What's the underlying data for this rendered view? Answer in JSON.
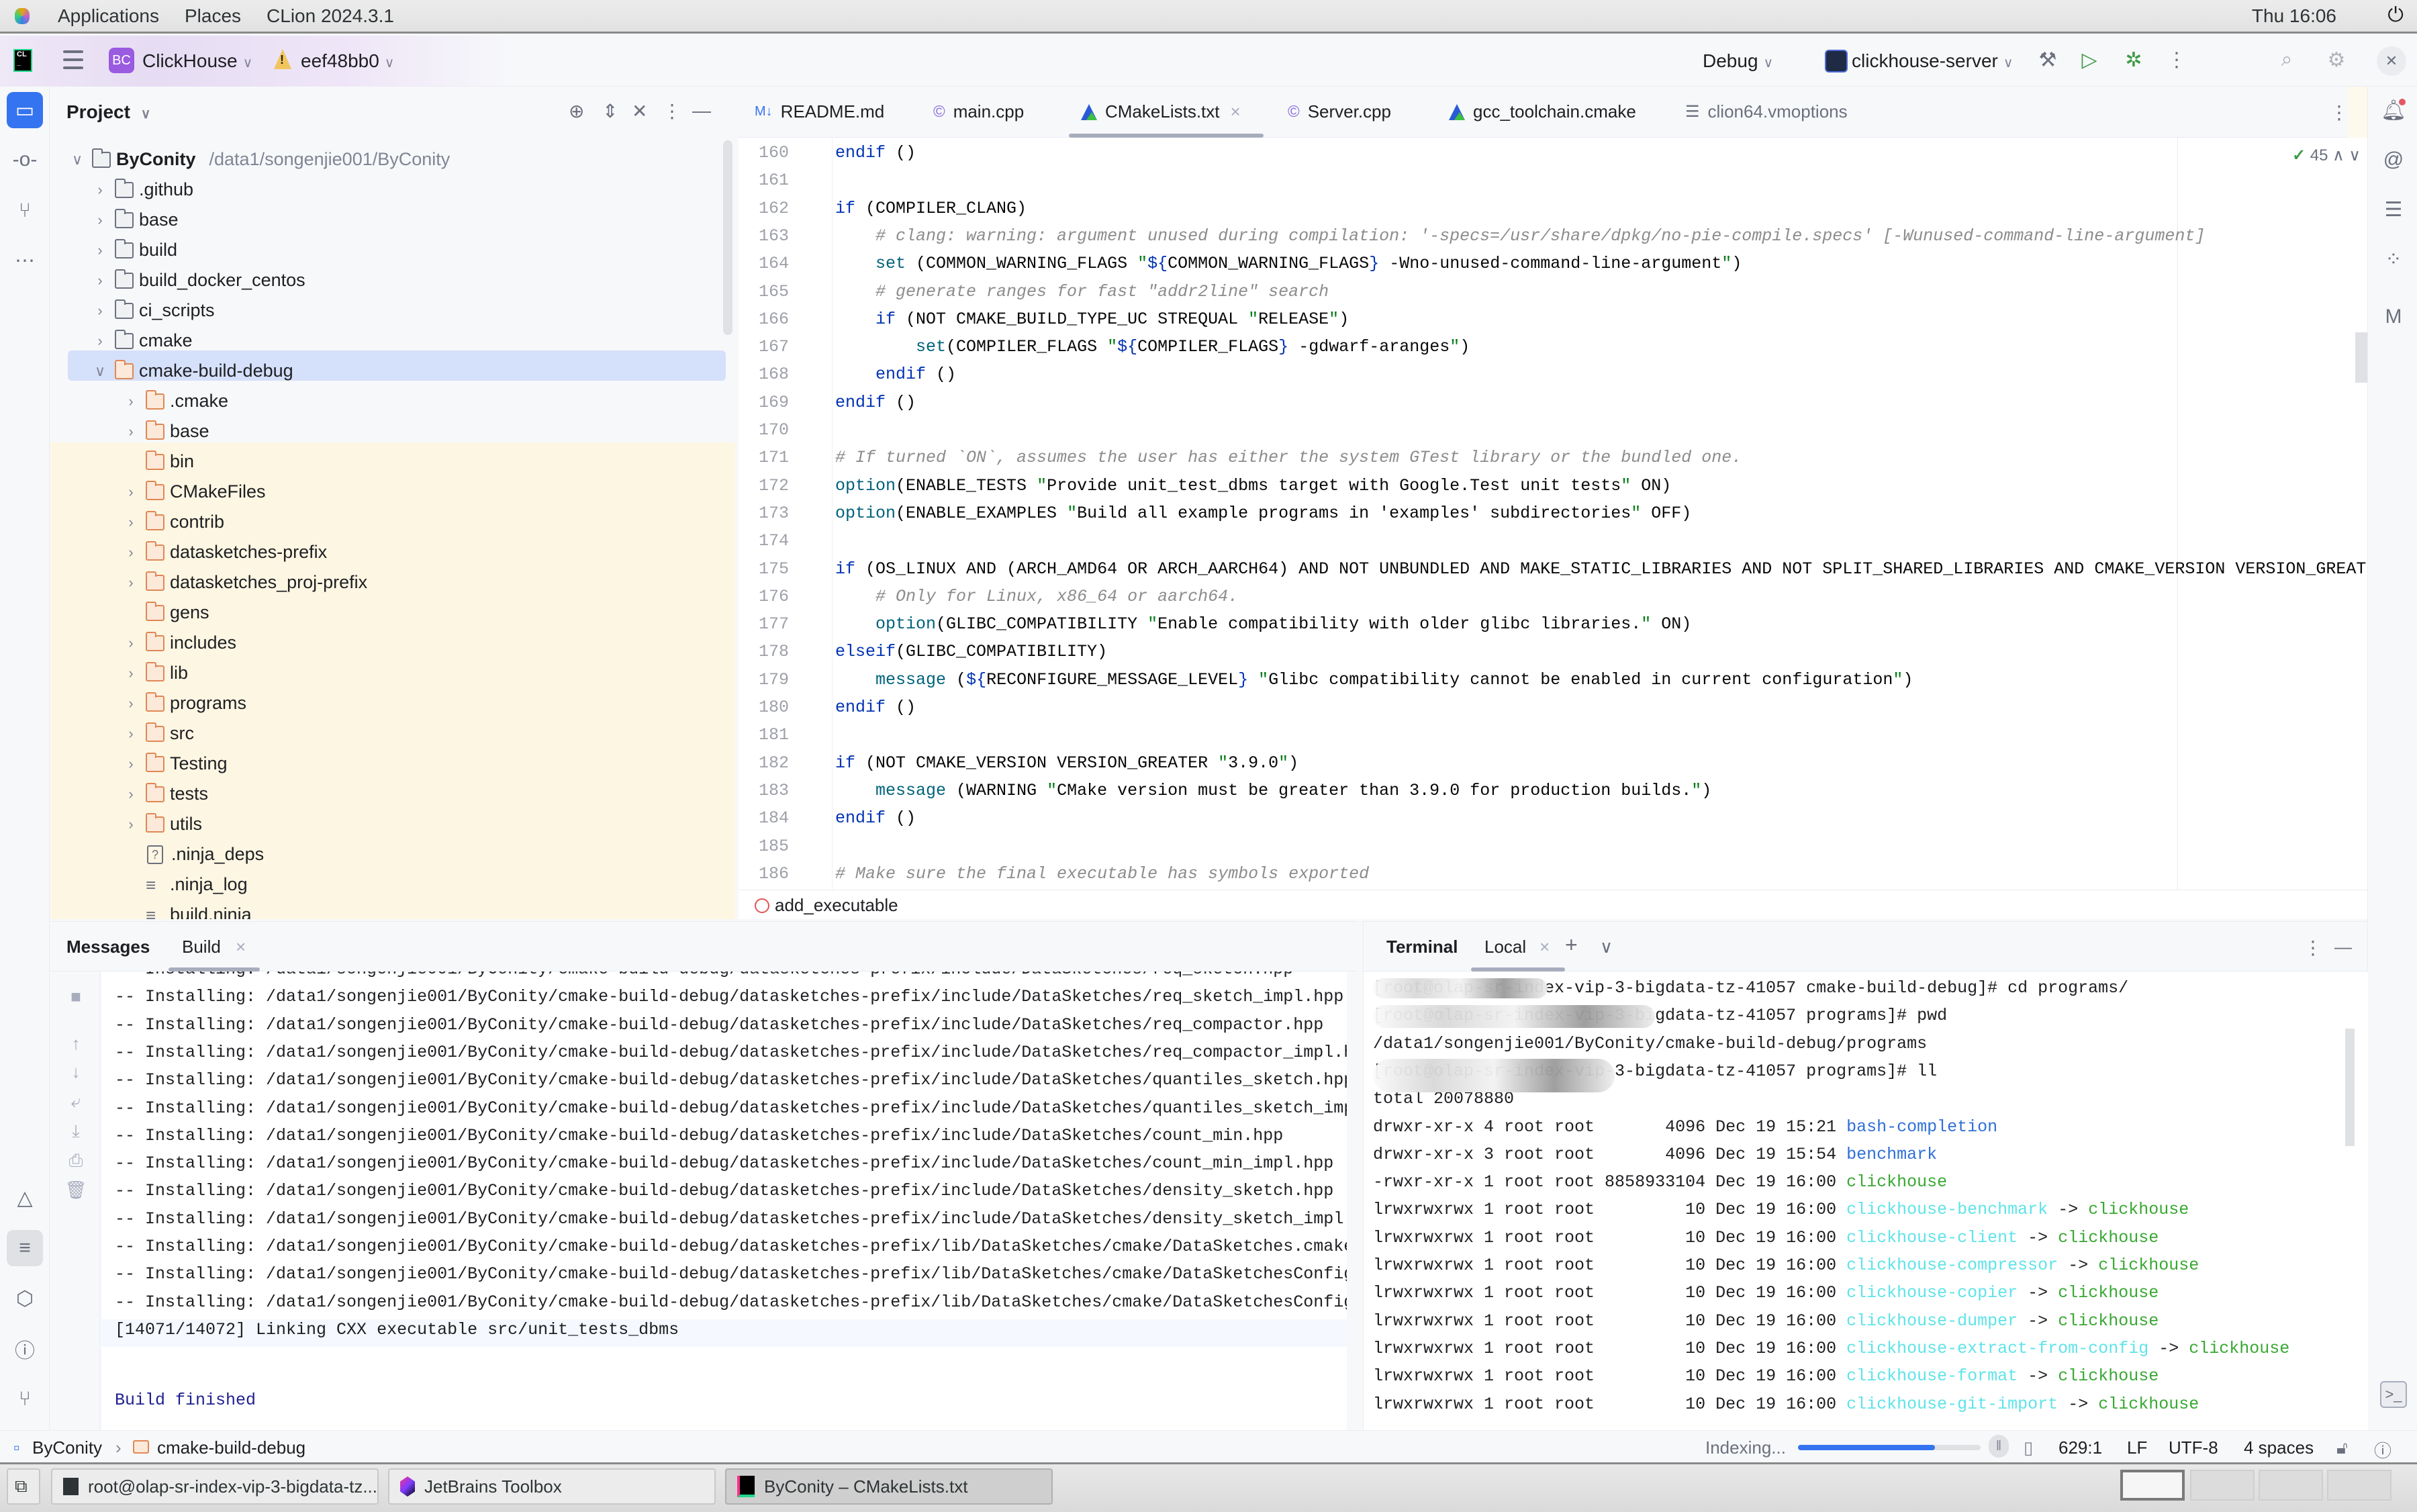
{
  "system_bar": {
    "menus": [
      "Applications",
      "Places",
      "CLion 2024.3.1"
    ],
    "clock": "Thu 16:06"
  },
  "header": {
    "project_badge": "BC",
    "project_name": "ClickHouse",
    "branch": "eef48bb0",
    "build_config": "Debug",
    "run_config": "clickhouse-server"
  },
  "project_panel": {
    "title": "Project",
    "root": {
      "name": "ByConity",
      "path": "/data1/songenjie001/ByConity"
    },
    "items": [
      {
        "name": ".github",
        "depth": 1,
        "type": "folder",
        "expandable": true
      },
      {
        "name": "base",
        "depth": 1,
        "type": "folder",
        "expandable": true
      },
      {
        "name": "build",
        "depth": 1,
        "type": "folder",
        "expandable": true
      },
      {
        "name": "build_docker_centos",
        "depth": 1,
        "type": "folder",
        "expandable": true
      },
      {
        "name": "ci_scripts",
        "depth": 1,
        "type": "folder",
        "expandable": true
      },
      {
        "name": "cmake",
        "depth": 1,
        "type": "folder",
        "expandable": true
      },
      {
        "name": "cmake-build-debug",
        "depth": 1,
        "type": "folder-excluded",
        "expandable": true,
        "expanded": true,
        "selected": true
      },
      {
        "name": ".cmake",
        "depth": 2,
        "type": "folder-excluded",
        "expandable": true
      },
      {
        "name": "base",
        "depth": 2,
        "type": "folder-excluded",
        "expandable": true
      },
      {
        "name": "bin",
        "depth": 2,
        "type": "folder-excluded",
        "expandable": false
      },
      {
        "name": "CMakeFiles",
        "depth": 2,
        "type": "folder-excluded",
        "expandable": true
      },
      {
        "name": "contrib",
        "depth": 2,
        "type": "folder-excluded",
        "expandable": true
      },
      {
        "name": "datasketches-prefix",
        "depth": 2,
        "type": "folder-excluded",
        "expandable": true
      },
      {
        "name": "datasketches_proj-prefix",
        "depth": 2,
        "type": "folder-excluded",
        "expandable": true
      },
      {
        "name": "gens",
        "depth": 2,
        "type": "folder-excluded",
        "expandable": false
      },
      {
        "name": "includes",
        "depth": 2,
        "type": "folder-excluded",
        "expandable": true
      },
      {
        "name": "lib",
        "depth": 2,
        "type": "folder-excluded",
        "expandable": true
      },
      {
        "name": "programs",
        "depth": 2,
        "type": "folder-excluded",
        "expandable": true
      },
      {
        "name": "src",
        "depth": 2,
        "type": "folder-excluded",
        "expandable": true
      },
      {
        "name": "Testing",
        "depth": 2,
        "type": "folder-excluded",
        "expandable": true
      },
      {
        "name": "tests",
        "depth": 2,
        "type": "folder-excluded",
        "expandable": true
      },
      {
        "name": "utils",
        "depth": 2,
        "type": "folder-excluded",
        "expandable": true
      },
      {
        "name": ".ninja_deps",
        "depth": 2,
        "type": "file-unknown",
        "expandable": false
      },
      {
        "name": ".ninja_log",
        "depth": 2,
        "type": "file-text",
        "expandable": false
      },
      {
        "name": "build.ninja",
        "depth": 2,
        "type": "file-text",
        "expandable": false
      }
    ]
  },
  "editor": {
    "tabs": [
      {
        "label": "README.md",
        "icon": "markdown-icon",
        "active": false
      },
      {
        "label": "main.cpp",
        "icon": "cpp-file-icon",
        "active": false
      },
      {
        "label": "CMakeLists.txt",
        "icon": "cmake-icon",
        "active": true,
        "closable": true
      },
      {
        "label": "Server.cpp",
        "icon": "cpp-file-icon",
        "active": false
      },
      {
        "label": "gcc_toolchain.cmake",
        "icon": "cmake-icon",
        "active": false
      },
      {
        "label": "clion64.vmoptions",
        "icon": "text-file-icon",
        "active": false
      }
    ],
    "inspection_count": "45",
    "lines": [
      {
        "n": "160",
        "html": "<span class='kw'>endif</span> ()"
      },
      {
        "n": "161",
        "html": ""
      },
      {
        "n": "162",
        "html": "<span class='kw'>if</span> (COMPILER_CLANG)"
      },
      {
        "n": "163",
        "html": "    <span class='cm'># clang: warning: argument unused during compilation: '-specs=/usr/share/dpkg/no-pie-compile.specs' [-Wunused-command-line-argument]</span>"
      },
      {
        "n": "164",
        "html": "    <span class='fn'>set</span> (COMMON_WARNING_FLAGS <span class='str'>\"</span><span class='var'>${</span>COMMON_WARNING_FLAGS<span class='var'>}</span> -Wno-unused-command-line-argument<span class='str'>\"</span>)"
      },
      {
        "n": "165",
        "html": "    <span class='cm'># generate ranges for fast \"addr2line\" search</span>"
      },
      {
        "n": "166",
        "html": "    <span class='kw'>if</span> (NOT CMAKE_BUILD_TYPE_UC STREQUAL <span class='str'>\"</span>RELEASE<span class='str'>\"</span>)"
      },
      {
        "n": "167",
        "html": "        <span class='fn'>set</span>(COMPILER_FLAGS <span class='str'>\"</span><span class='var'>${</span>COMPILER_FLAGS<span class='var'>}</span> -gdwarf-aranges<span class='str'>\"</span>)"
      },
      {
        "n": "168",
        "html": "    <span class='kw'>endif</span> ()"
      },
      {
        "n": "169",
        "html": "<span class='kw'>endif</span> ()"
      },
      {
        "n": "170",
        "html": ""
      },
      {
        "n": "171",
        "html": "<span class='cm'># If turned `ON`, assumes the user has either the system GTest library or the bundled one.</span>"
      },
      {
        "n": "172",
        "html": "<span class='fn'>option</span>(ENABLE_TESTS <span class='str'>\"</span>Provide unit_test_dbms target with Google.Test unit tests<span class='str'>\"</span> ON)"
      },
      {
        "n": "173",
        "html": "<span class='fn'>option</span>(ENABLE_EXAMPLES <span class='str'>\"</span>Build all example programs in 'examples' subdirectories<span class='str'>\"</span> OFF)"
      },
      {
        "n": "174",
        "html": ""
      },
      {
        "n": "175",
        "html": "<span class='kw'>if</span> (OS_LINUX AND (ARCH_AMD64 OR ARCH_AARCH64) AND NOT UNBUNDLED AND MAKE_STATIC_LIBRARIES AND NOT SPLIT_SHARED_LIBRARIES AND CMAKE_VERSION VERSION_GREAT"
      },
      {
        "n": "176",
        "html": "    <span class='cm'># Only for Linux, x86_64 or aarch64.</span>"
      },
      {
        "n": "177",
        "html": "    <span class='fn'>option</span>(GLIBC_COMPATIBILITY <span class='str'>\"</span>Enable compatibility with older glibc libraries.<span class='str'>\"</span> ON)"
      },
      {
        "n": "178",
        "html": "<span class='kw'>elseif</span>(GLIBC_COMPATIBILITY)"
      },
      {
        "n": "179",
        "html": "    <span class='fn'>message</span> (<span class='var'>${</span>RECONFIGURE_MESSAGE_LEVEL<span class='var'>}</span> <span class='str'>\"</span>Glibc compatibility cannot be enabled in current configuration<span class='str'>\"</span>)"
      },
      {
        "n": "180",
        "html": "<span class='kw'>endif</span> ()"
      },
      {
        "n": "181",
        "html": ""
      },
      {
        "n": "182",
        "html": "<span class='kw'>if</span> (NOT CMAKE_VERSION VERSION_GREATER <span class='str'>\"</span>3.9.0<span class='str'>\"</span>)"
      },
      {
        "n": "183",
        "html": "    <span class='fn'>message</span> (WARNING <span class='str'>\"</span>CMake version must be greater than 3.9.0 for production builds.<span class='str'>\"</span>)"
      },
      {
        "n": "184",
        "html": "<span class='kw'>endif</span> ()"
      },
      {
        "n": "185",
        "html": ""
      },
      {
        "n": "186",
        "html": "<span class='cm'># Make sure the final executable has symbols exported</span>"
      }
    ],
    "breadcrumb": "add_executable"
  },
  "messages_panel": {
    "title": "Messages",
    "tab": "Build",
    "lines": [
      "-- Installing: /data1/songenjie001/ByConity/cmake-build-debug/datasketches-prefix/include/DataSketches/req_sketch.hpp",
      "-- Installing: /data1/songenjie001/ByConity/cmake-build-debug/datasketches-prefix/include/DataSketches/req_sketch_impl.hpp",
      "-- Installing: /data1/songenjie001/ByConity/cmake-build-debug/datasketches-prefix/include/DataSketches/req_compactor.hpp",
      "-- Installing: /data1/songenjie001/ByConity/cmake-build-debug/datasketches-prefix/include/DataSketches/req_compactor_impl.hpp",
      "-- Installing: /data1/songenjie001/ByConity/cmake-build-debug/datasketches-prefix/include/DataSketches/quantiles_sketch.hpp",
      "-- Installing: /data1/songenjie001/ByConity/cmake-build-debug/datasketches-prefix/include/DataSketches/quantiles_sketch_impl.hpp",
      "-- Installing: /data1/songenjie001/ByConity/cmake-build-debug/datasketches-prefix/include/DataSketches/count_min.hpp",
      "-- Installing: /data1/songenjie001/ByConity/cmake-build-debug/datasketches-prefix/include/DataSketches/count_min_impl.hpp",
      "-- Installing: /data1/songenjie001/ByConity/cmake-build-debug/datasketches-prefix/include/DataSketches/density_sketch.hpp",
      "-- Installing: /data1/songenjie001/ByConity/cmake-build-debug/datasketches-prefix/include/DataSketches/density_sketch_impl.hpp",
      "-- Installing: /data1/songenjie001/ByConity/cmake-build-debug/datasketches-prefix/lib/DataSketches/cmake/DataSketches.cmake",
      "-- Installing: /data1/songenjie001/ByConity/cmake-build-debug/datasketches-prefix/lib/DataSketches/cmake/DataSketchesConfigVersion.cmake",
      "-- Installing: /data1/songenjie001/ByConity/cmake-build-debug/datasketches-prefix/lib/DataSketches/cmake/DataSketchesConfig.cmake",
      "[14071/14072] Linking CXX executable src/unit_tests_dbms"
    ],
    "status": "Build finished"
  },
  "terminal_panel": {
    "title": "Terminal",
    "tab": "Local",
    "lines": [
      {
        "text": "[root@olap-sr-index-vip-3-bigdata-tz-41057 cmake-build-debug]# cd programs/"
      },
      {
        "text": "[root@olap-sr-index-vip-3-bigdata-tz-41057 programs]# pwd"
      },
      {
        "text": "/data1/songenjie001/ByConity/cmake-build-debug/programs"
      },
      {
        "text": "[root@olap-sr-index-vip-3-bigdata-tz-41057 programs]# ll"
      },
      {
        "text": "total 20078880"
      }
    ],
    "listing": [
      {
        "meta": "drwxr-xr-x 4 root root       4096 Dec 19 15:21 ",
        "name": "bash-completion",
        "kind": "dir",
        "target": ""
      },
      {
        "meta": "drwxr-xr-x 3 root root       4096 Dec 19 15:54 ",
        "name": "benchmark",
        "kind": "dir",
        "target": ""
      },
      {
        "meta": "-rwxr-xr-x 1 root root 8858933104 Dec 19 16:00 ",
        "name": "clickhouse",
        "kind": "exe",
        "target": ""
      },
      {
        "meta": "lrwxrwxrwx 1 root root         10 Dec 19 16:00 ",
        "name": "clickhouse-benchmark",
        "kind": "link",
        "target": "clickhouse"
      },
      {
        "meta": "lrwxrwxrwx 1 root root         10 Dec 19 16:00 ",
        "name": "clickhouse-client",
        "kind": "link",
        "target": "clickhouse"
      },
      {
        "meta": "lrwxrwxrwx 1 root root         10 Dec 19 16:00 ",
        "name": "clickhouse-compressor",
        "kind": "link",
        "target": "clickhouse"
      },
      {
        "meta": "lrwxrwxrwx 1 root root         10 Dec 19 16:00 ",
        "name": "clickhouse-copier",
        "kind": "link",
        "target": "clickhouse"
      },
      {
        "meta": "lrwxrwxrwx 1 root root         10 Dec 19 16:00 ",
        "name": "clickhouse-dumper",
        "kind": "link",
        "target": "clickhouse"
      },
      {
        "meta": "lrwxrwxrwx 1 root root         10 Dec 19 16:00 ",
        "name": "clickhouse-extract-from-config",
        "kind": "link",
        "target": "clickhouse"
      },
      {
        "meta": "lrwxrwxrwx 1 root root         10 Dec 19 16:00 ",
        "name": "clickhouse-format",
        "kind": "link",
        "target": "clickhouse"
      },
      {
        "meta": "lrwxrwxrwx 1 root root         10 Dec 19 16:00 ",
        "name": "clickhouse-git-import",
        "kind": "link",
        "target": "clickhouse"
      }
    ]
  },
  "status_bar": {
    "breadcrumb": [
      "ByConity",
      "cmake-build-debug"
    ],
    "indexing_label": "Indexing...",
    "indexing_progress": 0.75,
    "caret": "629:1",
    "line_sep": "LF",
    "encoding": "UTF-8",
    "indent": "4 spaces"
  },
  "taskbar": {
    "tasks": [
      {
        "label": "root@olap-sr-index-vip-3-bigdata-tz...",
        "icon": "terminal-icon",
        "active": false
      },
      {
        "label": "JetBrains Toolbox",
        "icon": "jetbrains-toolbox-icon",
        "active": false
      },
      {
        "label": "ByConity – CMakeLists.txt",
        "icon": "clion-icon",
        "active": true
      }
    ],
    "workspaces": 4,
    "current_workspace": 1
  },
  "colors": {
    "accent": "#3574f0",
    "excluded_folder": "#e08855",
    "selection": "#d5e0fb",
    "terminal_dir": "#2f6fd8",
    "terminal_exe": "#38a832",
    "terminal_link": "#5fe3e8"
  }
}
